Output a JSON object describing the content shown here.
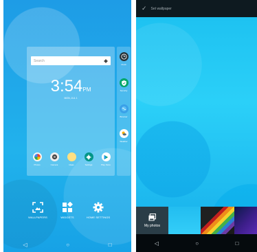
{
  "left": {
    "search": {
      "placeholder": "Search"
    },
    "clock": {
      "time": "3:54",
      "ampm": "PM",
      "date": "MON, JUL 1"
    },
    "dock_apps": [
      {
        "label": "Photos",
        "icon": "pinwheel-icon",
        "color": "#e8e8e8"
      },
      {
        "label": "Camera",
        "icon": "camera-icon",
        "color": "#444444"
      },
      {
        "label": "Ideas",
        "icon": "lightbulb-icon",
        "color": "#ffd54f"
      },
      {
        "label": "Settings",
        "icon": "gear-icon",
        "color": "#009688"
      },
      {
        "label": "Play Store",
        "icon": "play-store-icon",
        "color": "#ffffff"
      }
    ],
    "side_apps": [
      {
        "label": "Clock",
        "icon": "clock-icon",
        "color": "#263238"
      },
      {
        "label": "Security",
        "icon": "shield-icon",
        "color": "#00a66a"
      },
      {
        "label": "Browser",
        "icon": "globe-icon",
        "color": "#3aa0e8"
      },
      {
        "label": "Weather",
        "icon": "weather-icon",
        "color": "#ffffff"
      }
    ],
    "bottom_buttons": [
      {
        "label": "WALLPAPERS",
        "icon": "wallpaper-icon"
      },
      {
        "label": "WIDGETS",
        "icon": "widgets-icon"
      },
      {
        "label": "HOME SETTINGS",
        "icon": "gear-icon"
      }
    ],
    "nav": {
      "back": "◁",
      "home": "○",
      "recents": "□"
    }
  },
  "right": {
    "topbar": {
      "check": "✓",
      "title": "Set wallpaper"
    },
    "my_photos_label": "My photos",
    "nav": {
      "back": "◁",
      "home": "○",
      "recents": "□"
    }
  }
}
